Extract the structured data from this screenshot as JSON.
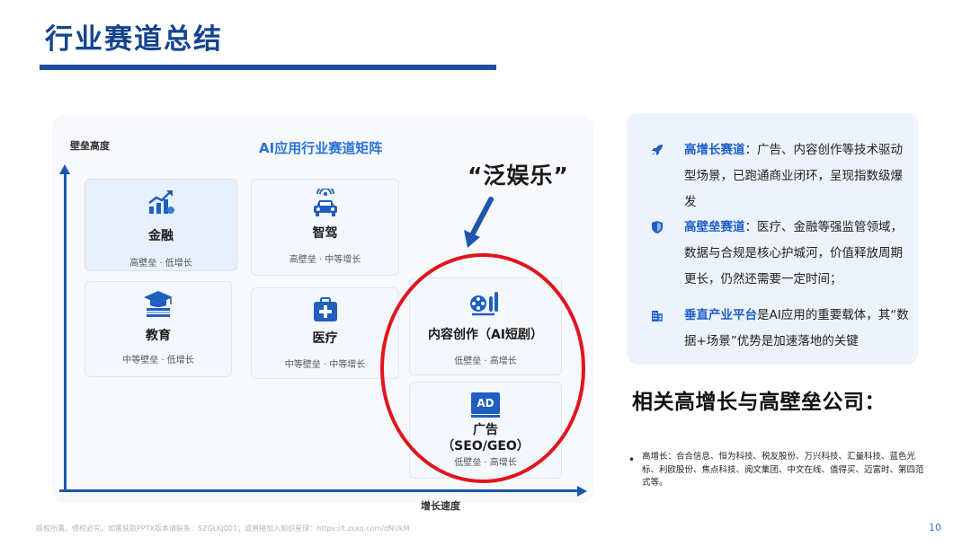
{
  "page": {
    "title": "行业赛道总结",
    "number": "10"
  },
  "matrix": {
    "title": "AI应用行业赛道矩阵",
    "y_axis_label": "壁垒高度",
    "x_axis_label": "增长速度",
    "callout": "“泛娱乐”",
    "cards": [
      {
        "name": "金融",
        "sub": "高壁垒 · 低增长",
        "icon": "chart-growth-icon"
      },
      {
        "name": "智驾",
        "sub": "高壁垒 · 中等增长",
        "icon": "car-signal-icon"
      },
      {
        "name": "教育",
        "sub": "中等壁垒 · 低增长",
        "icon": "graduation-cap-icon"
      },
      {
        "name": "医疗",
        "sub": "中等壁垒 · 中等增长",
        "icon": "medical-kit-icon"
      },
      {
        "name": "内容创作（AI短剧）",
        "sub": "低壁垒 · 高增长",
        "icon": "film-reel-icon"
      },
      {
        "name_line1": "广告",
        "name_line2": "（SEO/GEO）",
        "sub": "低壁垒 · 高增长",
        "icon": "ad-badge-icon",
        "badge_text": "AD"
      }
    ]
  },
  "summary": {
    "items": [
      {
        "icon": "rocket-icon",
        "keyword": "高增长赛道",
        "text": "：广告、内容创作等技术驱动型场景，已跑通商业闭环，呈现指数级爆发"
      },
      {
        "icon": "shield-icon",
        "keyword": "高壁垒赛道",
        "text": "：医疗、金融等强监管领域，数据与合规是核心护城河，价值释放周期更长，仍然还需要一定时间；"
      },
      {
        "icon": "building-icon",
        "keyword": "垂直产业平台",
        "text": "是AI应用的重要载体，其“数据+场景”优势是加速落地的关键"
      }
    ]
  },
  "related": {
    "heading": "相关高增长与高壁垒公司：",
    "bullet": "高增长：合合信息、恒为科技、税友股份、万兴科技、汇量科技、蓝色光标、利欧股份、焦点科技、阅文集团、中文在线、值得买、迈富时、第四范式等。",
    "bullet_marker": "•"
  },
  "footer": {
    "text": "版权所属，侵权必究。如需获取PPTX版本请联系：SZGLKJ001；或直接加入知识星球：https://t.zsxq.com/dNUkM"
  },
  "colors": {
    "title": "#13448f",
    "accent": "#1c57ad",
    "keyword": "#1e5ec8",
    "circle": "#e0161c",
    "info_bg": "#edf3fb"
  }
}
